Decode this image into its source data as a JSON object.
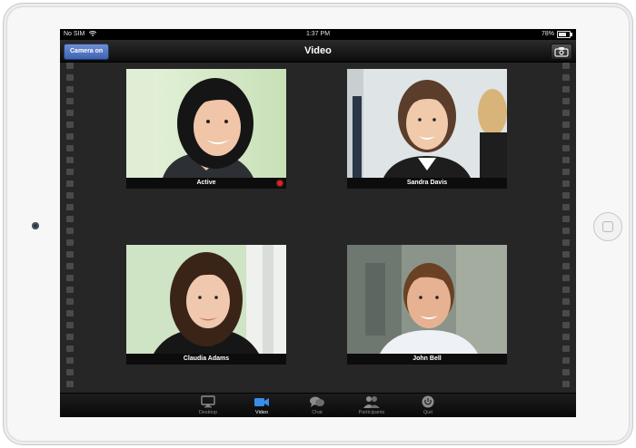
{
  "status_bar": {
    "carrier": "No SIM",
    "time": "1:37 PM",
    "battery": "78%"
  },
  "nav": {
    "title": "Video",
    "camera_button": "Camera on"
  },
  "participants": [
    {
      "name": "Active",
      "recording": true
    },
    {
      "name": "Sandra Davis",
      "recording": false
    },
    {
      "name": "Claudia Adams",
      "recording": false
    },
    {
      "name": "John Bell",
      "recording": false
    }
  ],
  "tabs": [
    {
      "label": "Desktop",
      "icon": "monitor-icon",
      "active": false
    },
    {
      "label": "Video",
      "icon": "video-camera-icon",
      "active": true
    },
    {
      "label": "Chat",
      "icon": "chat-bubbles-icon",
      "active": false
    },
    {
      "label": "Participants",
      "icon": "people-icon",
      "active": false
    },
    {
      "label": "Quit",
      "icon": "power-icon",
      "active": false
    }
  ],
  "colors": {
    "accent": "#3d63b6",
    "recording": "#e02020",
    "active_tab_icon": "#3a8ee6"
  }
}
